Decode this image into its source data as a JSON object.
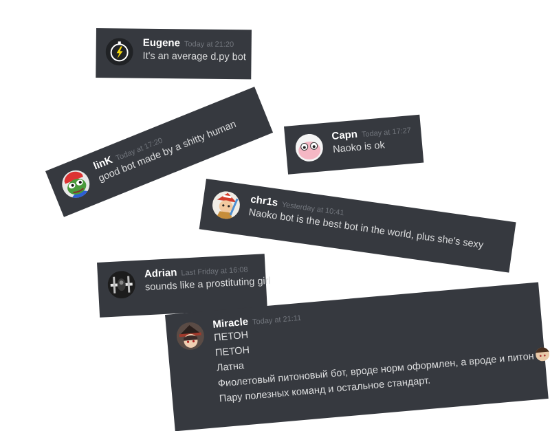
{
  "messages": [
    {
      "username": "Eugene",
      "timestamp": "Today at 21:20",
      "lines": [
        "It's an average d.py bot"
      ],
      "avatar_icon": "stopwatch-bolt-avatar"
    },
    {
      "username": "linK",
      "timestamp": "Today at 17:20",
      "lines": [
        "good bot made by a shitty human"
      ],
      "avatar_icon": "pepe-frog-avatar"
    },
    {
      "username": "Capn",
      "timestamp": "Today at 17:27",
      "lines": [
        "Naoko is ok"
      ],
      "avatar_icon": "pink-blob-avatar"
    },
    {
      "username": "chr1s",
      "timestamp": "Yesterday at 10:41",
      "lines": [
        "Naoko bot is the best bot in the world, plus she's sexy"
      ],
      "avatar_icon": "cartoon-character-avatar"
    },
    {
      "username": "Adrian",
      "timestamp": "Last Friday at 16:08",
      "lines": [
        "sounds like a prostituting girl"
      ],
      "avatar_icon": "dark-fighter-avatar"
    },
    {
      "username": "Miracle",
      "timestamp": "Today at 21:11",
      "lines": [
        "ПЕТОН",
        "ПЕТОН",
        "Латна",
        "Фиолетовый питоновый бот, вроде норм оформлен, а вроде и питон",
        "Пару полезных команд и остальное стандарт."
      ],
      "avatar_icon": "anime-witch-avatar",
      "inline_emoji": "anime-face-emoji"
    }
  ]
}
